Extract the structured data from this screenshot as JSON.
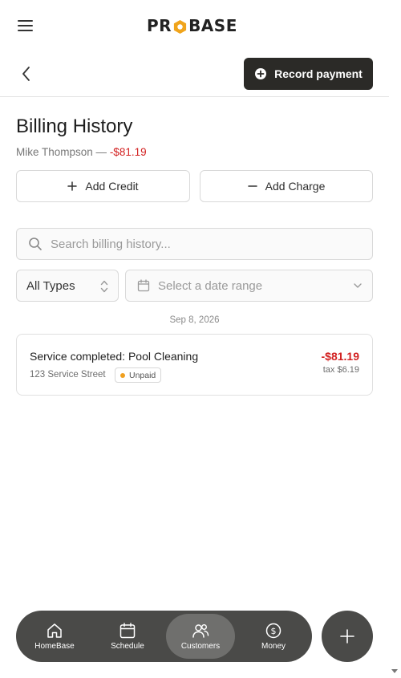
{
  "header": {
    "logo_text_left": "PR",
    "logo_text_right": "BASE",
    "logo_full": "PROBASE",
    "record_payment_label": "Record payment"
  },
  "page": {
    "title": "Billing History",
    "customer_name": "Mike Thompson",
    "separator": " — ",
    "balance": "-$81.19"
  },
  "actions": {
    "add_credit_label": "Add Credit",
    "add_charge_label": "Add Charge"
  },
  "filters": {
    "search_placeholder": "Search billing history...",
    "type_value": "All Types",
    "date_placeholder": "Select a date range"
  },
  "history": {
    "groups": [
      {
        "date": "Sep 8, 2026",
        "items": [
          {
            "title": "Service completed: Pool Cleaning",
            "address": "123 Service Street",
            "status": "Unpaid",
            "amount": "-$81.19",
            "tax": "tax $6.19"
          }
        ]
      }
    ]
  },
  "nav": {
    "items": [
      {
        "label": "HomeBase",
        "icon": "home-icon"
      },
      {
        "label": "Schedule",
        "icon": "calendar-icon"
      },
      {
        "label": "Customers",
        "icon": "users-icon",
        "active": true
      },
      {
        "label": "Money",
        "icon": "dollar-icon"
      }
    ]
  },
  "colors": {
    "accent_dark": "#2b2a27",
    "negative": "#d21f1f",
    "logo_hex": "#f0a41c",
    "nav_bg": "#4a4a48",
    "status_unpaid": "#f0a020"
  }
}
